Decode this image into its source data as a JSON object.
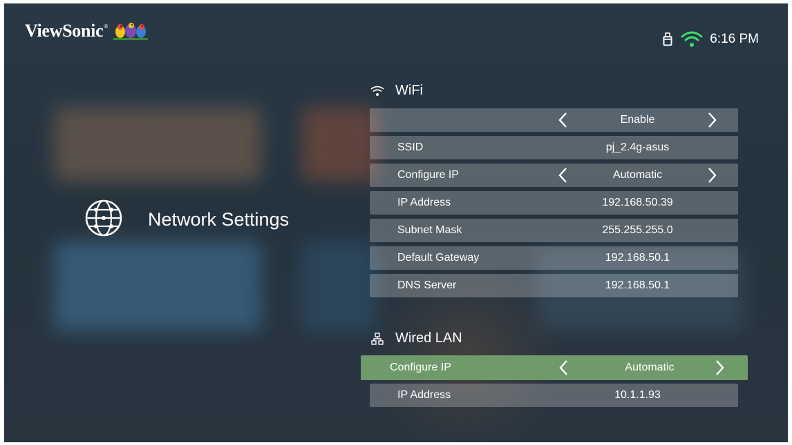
{
  "header": {
    "brand": "ViewSonic",
    "brand_mark": "®",
    "clock": "6:16 PM",
    "usb_icon": "usb-storage-icon",
    "wifi_icon": "wifi-connected-icon",
    "wifi_color": "#3ddc6a"
  },
  "page": {
    "title": "Network Settings",
    "icon": "globe-icon"
  },
  "wifi": {
    "title": "WiFi",
    "icon": "wifi-icon",
    "rows": [
      {
        "label": "",
        "value": "Enable",
        "has_arrows": true
      },
      {
        "label": "SSID",
        "value": "pj_2.4g-asus",
        "has_arrows": false
      },
      {
        "label": "Configure IP",
        "value": "Automatic",
        "has_arrows": true
      },
      {
        "label": "IP Address",
        "value": "192.168.50.39",
        "has_arrows": false
      },
      {
        "label": "Subnet Mask",
        "value": "255.255.255.0",
        "has_arrows": false
      },
      {
        "label": "Default Gateway",
        "value": "192.168.50.1",
        "has_arrows": false
      },
      {
        "label": "DNS Server",
        "value": "192.168.50.1",
        "has_arrows": false
      }
    ]
  },
  "wired": {
    "title": "Wired LAN",
    "icon": "network-icon",
    "rows": [
      {
        "label": "Configure IP",
        "value": "Automatic",
        "has_arrows": true,
        "selected": true
      },
      {
        "label": "IP Address",
        "value": "10.1.1.93",
        "has_arrows": false
      }
    ]
  },
  "colors": {
    "selected_row": "#6f9a6a",
    "row_bg": "rgba(255,255,255,0.24)"
  }
}
